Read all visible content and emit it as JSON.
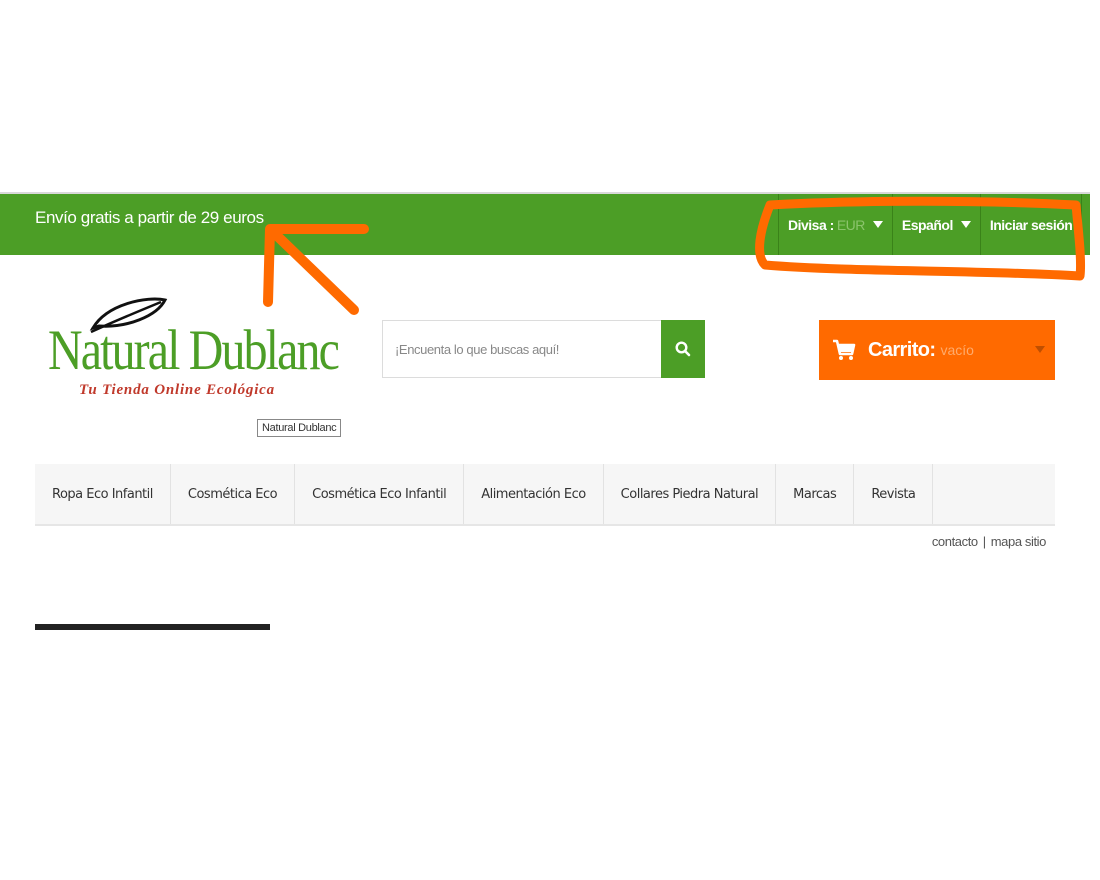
{
  "topbar": {
    "promo_text": "Envío gratis a partir de 29 euros",
    "currency_label": "Divisa :",
    "currency_value": "EUR",
    "language": "Español",
    "login": "Iniciar sesión"
  },
  "logo": {
    "name": "Natural Dublanc",
    "tagline": "Tu Tienda Online Ecológica",
    "tooltip": "Natural Dublanc"
  },
  "search": {
    "placeholder": "¡Encuenta lo que buscas aquí!"
  },
  "cart": {
    "label": "Carrito:",
    "status": "vacío"
  },
  "nav": {
    "items": [
      "Ropa Eco Infantil",
      "Cosmética Eco",
      "Cosmética Eco Infantil",
      "Alimentación Eco",
      "Collares Piedra Natural",
      "Marcas",
      "Revista"
    ]
  },
  "utility": {
    "contact": "contacto",
    "separator": "|",
    "sitemap": "mapa sitio"
  },
  "colors": {
    "brand_green": "#4c9e26",
    "cart_orange": "#ff6a00",
    "annotation_orange": "#ff6a00"
  },
  "icons": [
    "search-icon",
    "cart-icon",
    "leaf-icon",
    "chevron-down-icon"
  ]
}
